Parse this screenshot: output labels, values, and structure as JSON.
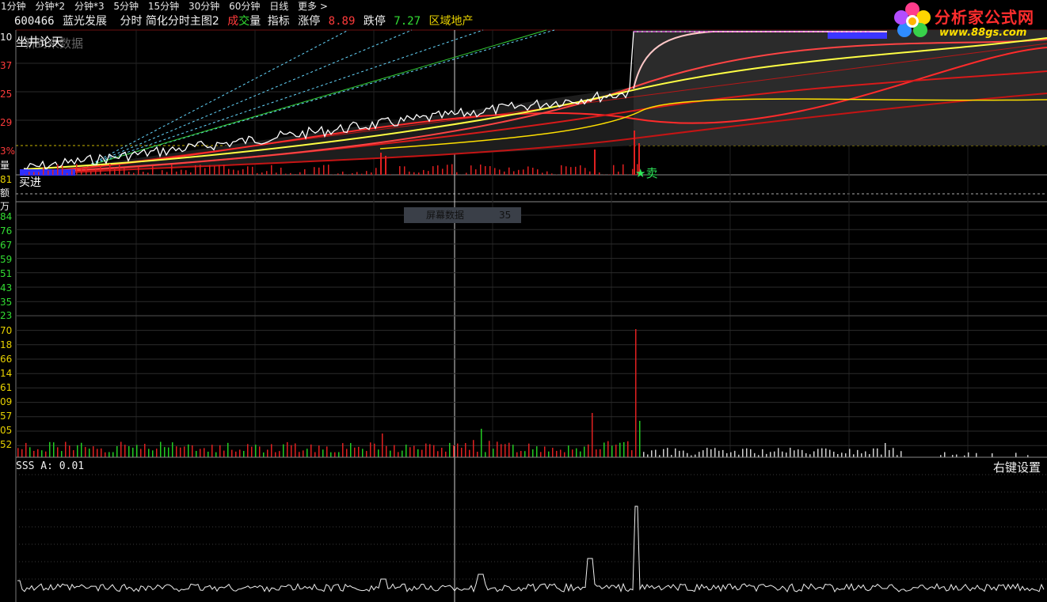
{
  "toolbar": {
    "timeframes": [
      "1分钟",
      "分钟*2",
      "分钟*3",
      "5分钟",
      "15分钟",
      "30分钟",
      "60分钟",
      "日线",
      "更多 >"
    ]
  },
  "header": {
    "code": "600466",
    "name": "蓝光发展",
    "mode": "分时 简化分时主图2",
    "vol_cheng": "成",
    "vol_jiao": "交",
    "vol_liang": "量",
    "indicator": "指标",
    "limit_up_label": "涨停",
    "limit_up_value": "8.89",
    "limit_down_label": "跌停",
    "limit_down_value": "7.27",
    "sector": "区域地产"
  },
  "logo": {
    "brand": "分析家公式网",
    "url": "www.88gs.com"
  },
  "main_chart": {
    "subtitle": "坐井论天",
    "subtitle2": "新到来数据",
    "axis_labels": [
      {
        "text": "10",
        "color": "#f0f0f0"
      },
      {
        "text": "37",
        "color": "#ff3b3b"
      },
      {
        "text": "25",
        "color": "#ff3b3b"
      },
      {
        "text": "29",
        "color": "#ff3b3b"
      },
      {
        "text": "3%",
        "color": "#ff3b3b"
      },
      {
        "text": "量",
        "color": "#f0f0f0"
      },
      {
        "text": "81",
        "color": "#e8d200"
      },
      {
        "text": "额",
        "color": "#f0f0f0"
      },
      {
        "text": "万",
        "color": "#f0f0f0"
      }
    ],
    "buy_label": "买进",
    "sell_label": "★卖"
  },
  "volume_chart": {
    "axis_labels": [
      {
        "text": "84",
        "color": "#33dd33"
      },
      {
        "text": "76",
        "color": "#33dd33"
      },
      {
        "text": "67",
        "color": "#33dd33"
      },
      {
        "text": "59",
        "color": "#33dd33"
      },
      {
        "text": "51",
        "color": "#33dd33"
      },
      {
        "text": "43",
        "color": "#33dd33"
      },
      {
        "text": "35",
        "color": "#33dd33"
      },
      {
        "text": "23",
        "color": "#33dd33"
      },
      {
        "text": "70",
        "color": "#e8d200"
      },
      {
        "text": "18",
        "color": "#e8d200"
      },
      {
        "text": "66",
        "color": "#e8d200"
      },
      {
        "text": "14",
        "color": "#e8d200"
      },
      {
        "text": "61",
        "color": "#e8d200"
      },
      {
        "text": "09",
        "color": "#e8d200"
      },
      {
        "text": "57",
        "color": "#e8d200"
      },
      {
        "text": "05",
        "color": "#e8d200"
      },
      {
        "text": "52",
        "color": "#e8d200"
      }
    ],
    "tooltip_key": "屏幕数据",
    "tooltip_value": "35"
  },
  "indicator_chart": {
    "label": "SSS A:  0.01",
    "right_setting": "右键设置"
  },
  "colors": {
    "up": "#ff3b3b",
    "down": "#33dd33",
    "grid": "#6b1010",
    "price": "#ffffff",
    "avg": "#ffff44"
  }
}
